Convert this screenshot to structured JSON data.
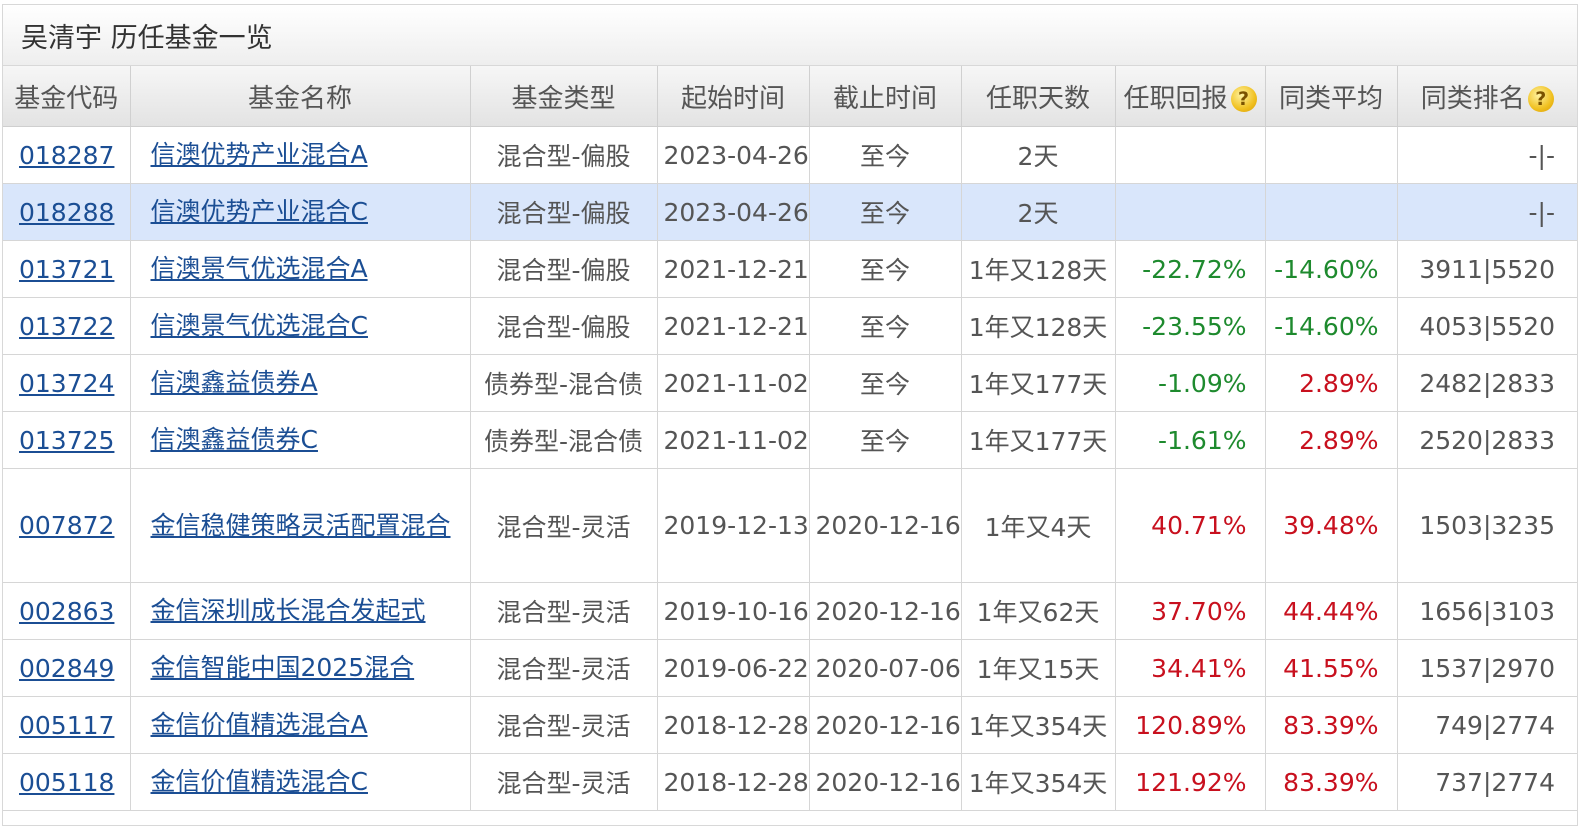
{
  "title": "吴清宇 历任基金一览",
  "headers": {
    "code": "基金代码",
    "name": "基金名称",
    "type": "基金类型",
    "start": "起始时间",
    "end": "截止时间",
    "days": "任职天数",
    "return": "任职回报",
    "avg": "同类平均",
    "rank": "同类排名",
    "help_icon": "?"
  },
  "colors": {
    "negative": "#1e8a2e",
    "positive": "#c8101e",
    "link": "#1b4e94",
    "highlight": "#d9e6fb"
  },
  "rows": [
    {
      "code": "018287",
      "name": "信澳优势产业混合A",
      "type": "混合型-偏股",
      "start": "2023-04-26",
      "end": "至今",
      "days": "2天",
      "return": "",
      "avg": "",
      "rank": "-|-"
    },
    {
      "code": "018288",
      "name": "信澳优势产业混合C",
      "type": "混合型-偏股",
      "start": "2023-04-26",
      "end": "至今",
      "days": "2天",
      "return": "",
      "avg": "",
      "rank": "-|-"
    },
    {
      "code": "013721",
      "name": "信澳景气优选混合A",
      "type": "混合型-偏股",
      "start": "2021-12-21",
      "end": "至今",
      "days": "1年又128天",
      "return": "-22.72%",
      "avg": "-14.60%",
      "rank": "3911|5520"
    },
    {
      "code": "013722",
      "name": "信澳景气优选混合C",
      "type": "混合型-偏股",
      "start": "2021-12-21",
      "end": "至今",
      "days": "1年又128天",
      "return": "-23.55%",
      "avg": "-14.60%",
      "rank": "4053|5520"
    },
    {
      "code": "013724",
      "name": "信澳鑫益债券A",
      "type": "债券型-混合债",
      "start": "2021-11-02",
      "end": "至今",
      "days": "1年又177天",
      "return": "-1.09%",
      "avg": "2.89%",
      "rank": "2482|2833"
    },
    {
      "code": "013725",
      "name": "信澳鑫益债券C",
      "type": "债券型-混合债",
      "start": "2021-11-02",
      "end": "至今",
      "days": "1年又177天",
      "return": "-1.61%",
      "avg": "2.89%",
      "rank": "2520|2833"
    },
    {
      "code": "007872",
      "name": "金信稳健策略灵活配置混合",
      "type": "混合型-灵活",
      "start": "2019-12-13",
      "end": "2020-12-16",
      "days": "1年又4天",
      "return": "40.71%",
      "avg": "39.48%",
      "rank": "1503|3235"
    },
    {
      "code": "002863",
      "name": "金信深圳成长混合发起式",
      "type": "混合型-灵活",
      "start": "2019-10-16",
      "end": "2020-12-16",
      "days": "1年又62天",
      "return": "37.70%",
      "avg": "44.44%",
      "rank": "1656|3103"
    },
    {
      "code": "002849",
      "name": "金信智能中国2025混合",
      "type": "混合型-灵活",
      "start": "2019-06-22",
      "end": "2020-07-06",
      "days": "1年又15天",
      "return": "34.41%",
      "avg": "41.55%",
      "rank": "1537|2970"
    },
    {
      "code": "005117",
      "name": "金信价值精选混合A",
      "type": "混合型-灵活",
      "start": "2018-12-28",
      "end": "2020-12-16",
      "days": "1年又354天",
      "return": "120.89%",
      "avg": "83.39%",
      "rank": "749|2774"
    },
    {
      "code": "005118",
      "name": "金信价值精选混合C",
      "type": "混合型-灵活",
      "start": "2018-12-28",
      "end": "2020-12-16",
      "days": "1年又354天",
      "return": "121.92%",
      "avg": "83.39%",
      "rank": "737|2774"
    }
  ]
}
